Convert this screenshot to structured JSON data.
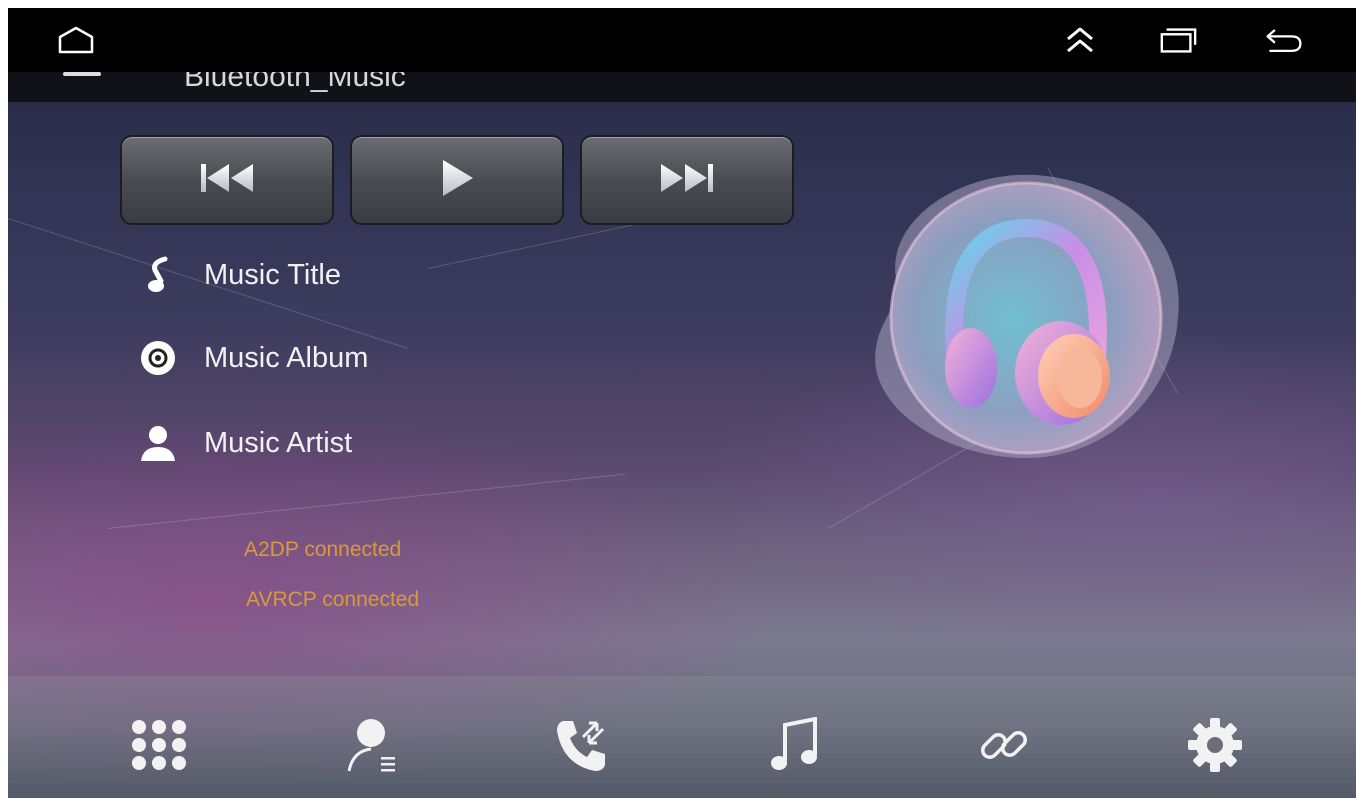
{
  "system_bar": {
    "icons": [
      "home-icon",
      "expand-up-icon",
      "recent-apps-icon",
      "back-icon"
    ]
  },
  "app": {
    "title": "Bluetooth_Music"
  },
  "controls": {
    "icons": [
      "skip-previous-icon",
      "play-icon",
      "skip-next-icon"
    ]
  },
  "track": {
    "title": "Music Title",
    "album": "Music Album",
    "artist": "Music Artist"
  },
  "connection": {
    "a2dp": "A2DP connected",
    "avrcp": "AVRCP connected"
  },
  "bottom_nav": {
    "icons": [
      "dialpad-icon",
      "contacts-icon",
      "call-log-icon",
      "music-icon",
      "link-icon",
      "settings-icon"
    ]
  },
  "colors": {
    "status_text": "#d89a3a",
    "label_text": "#f2f2f2"
  }
}
